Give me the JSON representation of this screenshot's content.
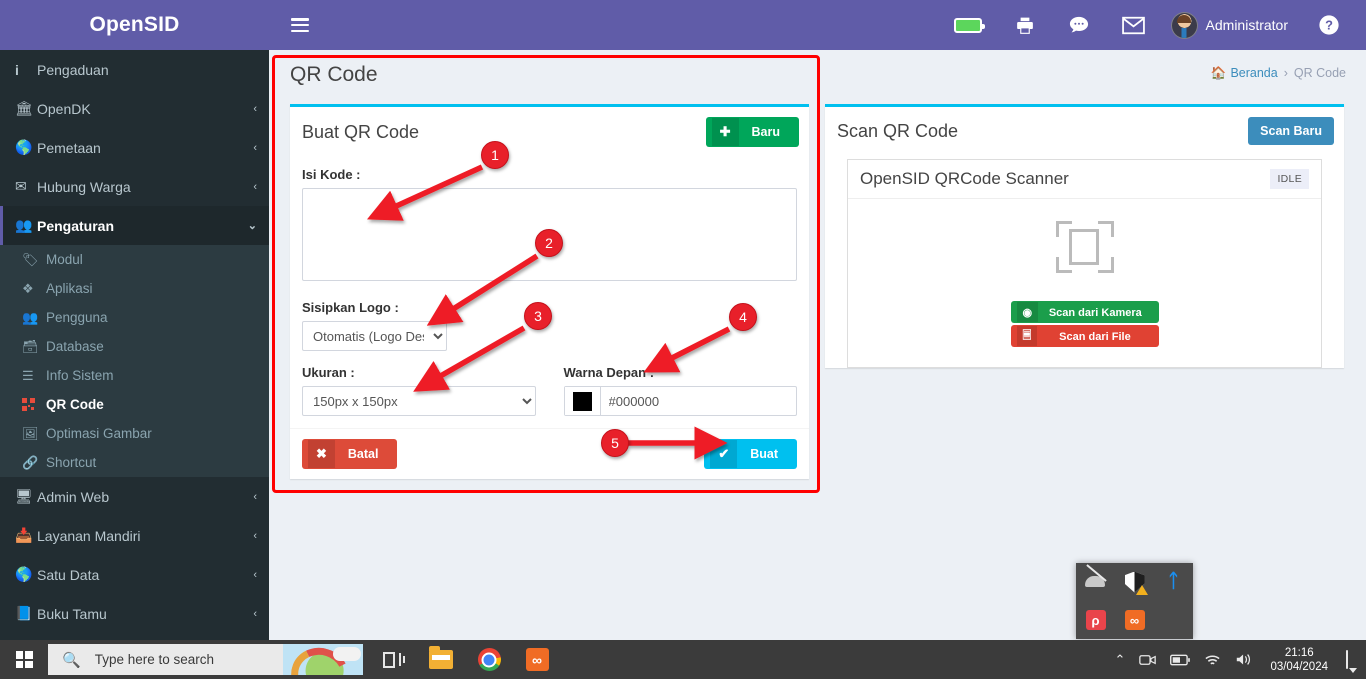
{
  "brand": {
    "logo_text": "OpenSID"
  },
  "navbar": {
    "hamburger_icon": "hamburger-icon",
    "items": [
      {
        "icon": "battery-icon",
        "name": "battery"
      },
      {
        "icon": "printer-icon",
        "name": "printer"
      },
      {
        "icon": "chat-icon",
        "name": "chat"
      },
      {
        "icon": "envelope-icon",
        "name": "envelope"
      }
    ],
    "user_name": "Administrator",
    "help_icon": "help-circle-icon"
  },
  "sidebar": {
    "items": [
      {
        "label": "Pengaduan",
        "icon": "info-icon",
        "caret": "",
        "active": false
      },
      {
        "label": "OpenDK",
        "icon": "bank-icon",
        "caret": "‹",
        "active": false
      },
      {
        "label": "Pemetaan",
        "icon": "globe-icon",
        "caret": "‹",
        "active": false
      },
      {
        "label": "Hubung Warga",
        "icon": "envelope-icon",
        "caret": "‹",
        "active": false
      },
      {
        "label": "Pengaturan",
        "icon": "users-icon",
        "caret": "⌄",
        "active": true
      }
    ],
    "sub_items": [
      {
        "label": "Modul",
        "icon": "tag-icon",
        "active": false
      },
      {
        "label": "Aplikasi",
        "icon": "cube-icon",
        "active": false
      },
      {
        "label": "Pengguna",
        "icon": "users-icon",
        "active": false
      },
      {
        "label": "Database",
        "icon": "database-icon",
        "active": false
      },
      {
        "label": "Info Sistem",
        "icon": "server-icon",
        "active": false
      },
      {
        "label": "QR Code",
        "icon": "qrcode-icon",
        "active": true
      },
      {
        "label": "Optimasi Gambar",
        "icon": "image-icon",
        "active": false
      },
      {
        "label": "Shortcut",
        "icon": "link-icon",
        "active": false
      }
    ],
    "items_after": [
      {
        "label": "Admin Web",
        "icon": "desktop-icon",
        "caret": "‹"
      },
      {
        "label": "Layanan Mandiri",
        "icon": "inbox-icon",
        "caret": "‹"
      },
      {
        "label": "Satu Data",
        "icon": "globe-icon",
        "caret": "‹"
      },
      {
        "label": "Buku Tamu",
        "icon": "book-icon",
        "caret": "‹"
      }
    ]
  },
  "content": {
    "page_title": "QR Code",
    "breadcrumb": {
      "home_icon": "home-icon",
      "home_label": "Beranda",
      "separator": "›",
      "current": "QR Code"
    }
  },
  "create_panel": {
    "title": "Buat QR Code",
    "new_button": {
      "label": "Baru",
      "icon": "plus-icon",
      "color": "#00a65a"
    },
    "fields": {
      "code_label": "Isi Kode :",
      "code_value": "",
      "code_placeholder": "",
      "logo_label": "Sisipkan Logo :",
      "logo_value": "Otomatis (Logo Desa)",
      "logo_options": [
        "Otomatis (Logo Desa)"
      ],
      "size_label": "Ukuran :",
      "size_value": "150px x 150px",
      "size_options": [
        "150px x 150px"
      ],
      "color_label": "Warna Depan :",
      "color_value": "#000000",
      "color_swatch": "#000000"
    },
    "cancel_button": {
      "label": "Batal",
      "icon": "x-icon",
      "color": "#dd4b39"
    },
    "submit_button": {
      "label": "Buat",
      "icon": "check-icon",
      "color": "#00c0ef"
    }
  },
  "scan_panel": {
    "title": "Scan QR Code",
    "new_button": {
      "label": "Scan Baru",
      "color": "#3c8dbc"
    },
    "scanner": {
      "title": "OpenSID QRCode Scanner",
      "status": "IDLE",
      "frame_icon": "scan-frame-icon",
      "camera_button": {
        "label": "Scan dari Kamera",
        "icon": "camera-icon",
        "color": "#1b9e4b"
      },
      "file_button": {
        "label": "Scan dari File",
        "icon": "file-image-icon",
        "color": "#e04233"
      }
    }
  },
  "annotations": {
    "marker_color": "#e8202a",
    "markers": [
      {
        "number": "1",
        "target": "code-textarea"
      },
      {
        "number": "2",
        "target": "logo-select"
      },
      {
        "number": "3",
        "target": "size-select"
      },
      {
        "number": "4",
        "target": "color-input"
      },
      {
        "number": "5",
        "target": "submit-button"
      }
    ]
  },
  "taskbar": {
    "start_icon": "windows-start-icon",
    "search_placeholder": "Type here to search",
    "icons": [
      {
        "name": "task-view-icon"
      },
      {
        "name": "file-explorer-icon"
      },
      {
        "name": "chrome-icon"
      },
      {
        "name": "xampp-icon"
      }
    ],
    "tray": {
      "chevron": "⌃",
      "items": [
        "camera-tray-icon",
        "battery-tray-icon",
        "wifi-tray-icon",
        "volume-tray-icon"
      ],
      "time": "21:16",
      "date": "03/04/2024",
      "notification_icon": "action-center-icon"
    },
    "flyout": {
      "items": [
        {
          "name": "display-off-icon"
        },
        {
          "name": "security-shield-warning-icon"
        },
        {
          "name": "bluetooth-icon"
        },
        {
          "name": "pink-app-icon",
          "glyph": "р"
        },
        {
          "name": "xampp-tray-icon",
          "glyph": "∞"
        }
      ]
    }
  }
}
